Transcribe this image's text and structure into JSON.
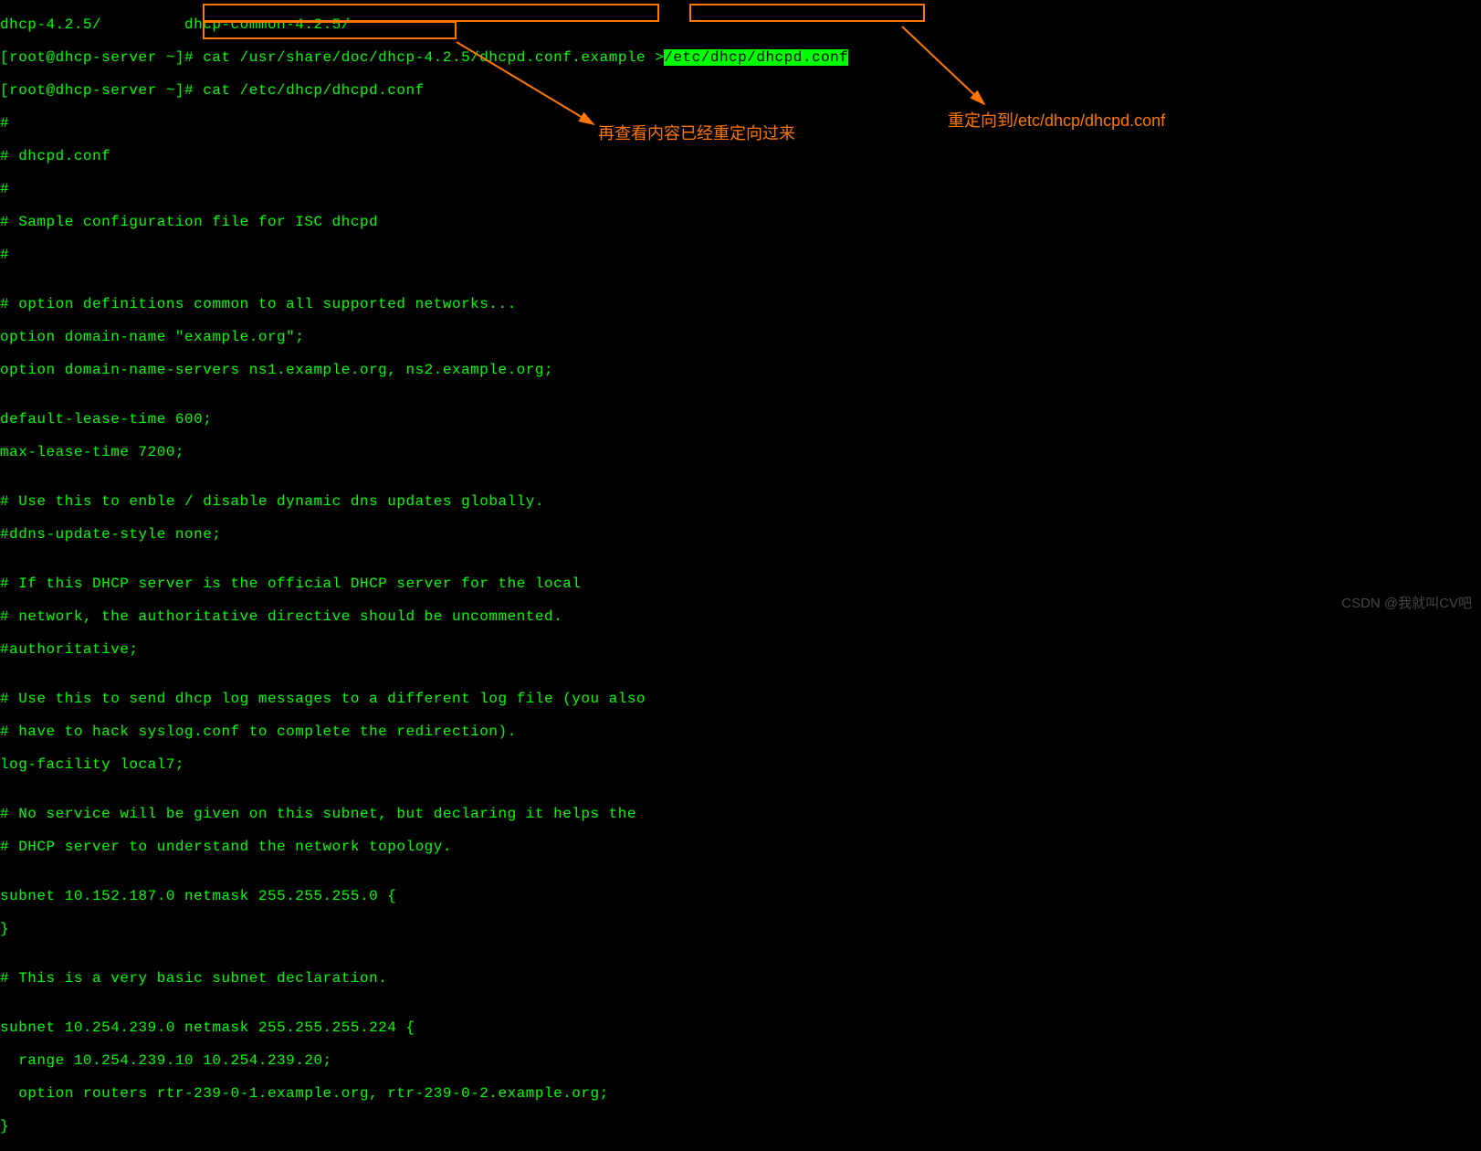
{
  "lines": {
    "l0a": "dhcp-4.2.5/",
    "l0b": "         dhcp-common-4.2.5/",
    "prompt1_user": "[root@dhcp-server ~]#",
    "prompt1_cmd": " cat /usr/share/doc/dhcp-4.2.5/dhcpd.conf.example ",
    "prompt1_gt": ">",
    "prompt1_target": "/etc/dhcp/dhcpd.conf",
    "prompt2_user": "[root@dhcp-server ~]#",
    "prompt2_cmd": " cat /etc/dhcp/dhcpd.conf",
    "c0": "#",
    "c1": "# dhcpd.conf",
    "c2": "#",
    "c3": "# Sample configuration file for ISC dhcpd",
    "c4": "#",
    "c5": "",
    "c6": "# option definitions common to all supported networks...",
    "c7": "option domain-name \"example.org\";",
    "c8": "option domain-name-servers ns1.example.org, ns2.example.org;",
    "c9": "",
    "c10": "default-lease-time 600;",
    "c11": "max-lease-time 7200;",
    "c12": "",
    "c13": "# Use this to enble / disable dynamic dns updates globally.",
    "c14": "#ddns-update-style none;",
    "c15": "",
    "c16": "# If this DHCP server is the official DHCP server for the local",
    "c17": "# network, the authoritative directive should be uncommented.",
    "c18": "#authoritative;",
    "c19": "",
    "c20": "# Use this to send dhcp log messages to a different log file (you also",
    "c21": "# have to hack syslog.conf to complete the redirection).",
    "c22": "log-facility local7;",
    "c23": "",
    "c24": "# No service will be given on this subnet, but declaring it helps the",
    "c25": "# DHCP server to understand the network topology.",
    "c26": "",
    "c27": "subnet 10.152.187.0 netmask 255.255.255.0 {",
    "c28": "}",
    "c29": "",
    "c30": "# This is a very basic subnet declaration.",
    "c31": "",
    "c32": "subnet 10.254.239.0 netmask 255.255.255.224 {",
    "c33": "  range 10.254.239.10 10.254.239.20;",
    "c34": "  option routers rtr-239-0-1.example.org, rtr-239-0-2.example.org;",
    "c35": "}"
  },
  "annotations": {
    "a1": "再查看内容已经重定向过来",
    "a2": "重定向到/etc/dhcp/dhcpd.conf"
  },
  "watermark": "CSDN @我就叫CV吧"
}
